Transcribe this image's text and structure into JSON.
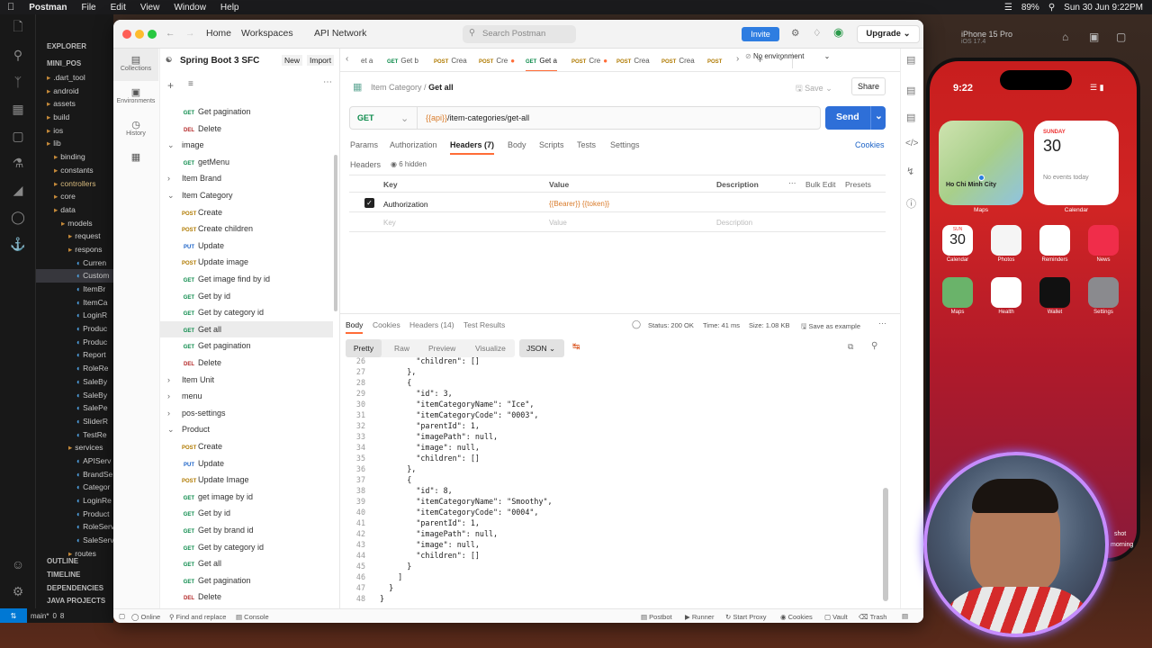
{
  "menubar": {
    "app": "Postman",
    "items": [
      "File",
      "Edit",
      "View",
      "Window",
      "Help"
    ],
    "battery": "89%",
    "datetime": "Sun 30 Jun  9:22PM"
  },
  "vscode": {
    "explorer": "EXPLORER",
    "project": "MINI_POS",
    "tree": [
      ".dart_tool",
      "android",
      "assets",
      "build",
      "ios",
      "lib",
      "binding",
      "constants",
      "controllers",
      "core",
      "data",
      "models",
      "request",
      "respons",
      "Curren",
      "Custom",
      "ItemBr",
      "ItemCa",
      "LoginR",
      "Produc",
      "Produc",
      "Report",
      "RoleRe",
      "SaleBy",
      "SaleBy",
      "SalePe",
      "SliderR",
      "TestRe",
      "services",
      "APIServ",
      "BrandSe",
      "Categor",
      "LoginRe",
      "Product",
      "RoleServ",
      "SaleServ",
      "routes"
    ],
    "outline": "OUTLINE",
    "timeline": "TIMELINE",
    "dependencies": "DEPENDENCIES",
    "java": "JAVA PROJECTS",
    "branch": "main*",
    "errors": "0",
    "warnings": "8"
  },
  "pm": {
    "nav": {
      "home": "Home",
      "workspaces": "Workspaces",
      "api": "API Network",
      "search": "Search Postman",
      "invite": "Invite",
      "upgrade": "Upgrade"
    },
    "workspace": {
      "name": "Spring Boot 3 SFC",
      "new": "New",
      "import": "Import"
    },
    "sidebar": {
      "collections": "Collections",
      "environments": "Environments",
      "history": "History"
    },
    "tree": [
      {
        "m": "GET",
        "t": "Get pagination"
      },
      {
        "m": "DEL",
        "t": "Delete"
      },
      {
        "f": "open",
        "t": "image"
      },
      {
        "m": "GET",
        "t": "getMenu"
      },
      {
        "f": "closed",
        "t": "Item Brand"
      },
      {
        "f": "open",
        "t": "Item Category"
      },
      {
        "m": "POST",
        "t": "Create"
      },
      {
        "m": "POST",
        "t": "Create children"
      },
      {
        "m": "PUT",
        "t": "Update"
      },
      {
        "m": "POST",
        "t": "Update image"
      },
      {
        "m": "GET",
        "t": "Get image find by id"
      },
      {
        "m": "GET",
        "t": "Get by id"
      },
      {
        "m": "GET",
        "t": "Get by category id"
      },
      {
        "m": "GET",
        "t": "Get all"
      },
      {
        "m": "GET",
        "t": "Get pagination"
      },
      {
        "m": "DEL",
        "t": "Delete"
      },
      {
        "f": "closed",
        "t": "Item Unit"
      },
      {
        "f": "closed",
        "t": "menu"
      },
      {
        "f": "closed",
        "t": "pos-settings"
      },
      {
        "f": "open",
        "t": "Product"
      },
      {
        "m": "POST",
        "t": "Create"
      },
      {
        "m": "PUT",
        "t": "Update"
      },
      {
        "m": "POST",
        "t": "Update Image"
      },
      {
        "m": "GET",
        "t": "get image by id"
      },
      {
        "m": "GET",
        "t": "Get by id"
      },
      {
        "m": "GET",
        "t": "Get by brand id"
      },
      {
        "m": "GET",
        "t": "Get by category id"
      },
      {
        "m": "GET",
        "t": "Get all"
      },
      {
        "m": "GET",
        "t": "Get pagination"
      },
      {
        "m": "DEL",
        "t": "Delete"
      }
    ],
    "tabs": [
      {
        "m": "",
        "t": "et a"
      },
      {
        "m": "GET",
        "t": "Get b"
      },
      {
        "m": "POST",
        "t": "Crea"
      },
      {
        "m": "POST",
        "t": "Cre"
      },
      {
        "m": "GET",
        "t": "Get a"
      },
      {
        "m": "POST",
        "t": "Cre"
      },
      {
        "m": "POST",
        "t": "Crea"
      },
      {
        "m": "POST",
        "t": "Crea"
      },
      {
        "m": "POST",
        "t": ""
      }
    ],
    "env": "No environment",
    "crumb": {
      "parent": "Item Category",
      "current": "Get all"
    },
    "save": "Save",
    "share": "Share",
    "method": "GET",
    "url_var": "{{api}}",
    "url_path": "/item-categories/get-all",
    "send": "Send",
    "reqtabs": [
      "Params",
      "Authorization",
      "Headers (7)",
      "Body",
      "Scripts",
      "Tests",
      "Settings"
    ],
    "cookies": "Cookies",
    "headers_label": "Headers",
    "hidden": "6 hidden",
    "cols": {
      "key": "Key",
      "value": "Value",
      "desc": "Description",
      "bulk": "Bulk Edit",
      "presets": "Presets"
    },
    "row": {
      "key": "Authorization",
      "value": "{{Bearer}} {{token}}"
    },
    "empty": {
      "key": "Key",
      "value": "Value",
      "desc": "Description"
    },
    "resptabs": [
      "Body",
      "Cookies",
      "Headers (14)",
      "Test Results"
    ],
    "status": "Status: 200 OK",
    "time": "Time: 41 ms",
    "size": "Size: 1.08 KB",
    "saveex": "Save as example",
    "views": [
      "Pretty",
      "Raw",
      "Preview",
      "Visualize"
    ],
    "format": "JSON",
    "code": [
      {
        "n": "26",
        "t": "        \"children\": []"
      },
      {
        "n": "27",
        "t": "      },"
      },
      {
        "n": "28",
        "t": "      {"
      },
      {
        "n": "29",
        "t": "        \"id\": 3,"
      },
      {
        "n": "30",
        "t": "        \"itemCategoryName\": \"Ice\","
      },
      {
        "n": "31",
        "t": "        \"itemCategoryCode\": \"0003\","
      },
      {
        "n": "32",
        "t": "        \"parentId\": 1,"
      },
      {
        "n": "33",
        "t": "        \"imagePath\": null,"
      },
      {
        "n": "34",
        "t": "        \"image\": null,"
      },
      {
        "n": "35",
        "t": "        \"children\": []"
      },
      {
        "n": "36",
        "t": "      },"
      },
      {
        "n": "37",
        "t": "      {"
      },
      {
        "n": "38",
        "t": "        \"id\": 8,"
      },
      {
        "n": "39",
        "t": "        \"itemCategoryName\": \"Smoothy\","
      },
      {
        "n": "40",
        "t": "        \"itemCategoryCode\": \"0004\","
      },
      {
        "n": "41",
        "t": "        \"parentId\": 1,"
      },
      {
        "n": "42",
        "t": "        \"imagePath\": null,"
      },
      {
        "n": "43",
        "t": "        \"image\": null,"
      },
      {
        "n": "44",
        "t": "        \"children\": []"
      },
      {
        "n": "45",
        "t": "      }"
      },
      {
        "n": "46",
        "t": "    ]"
      },
      {
        "n": "47",
        "t": "  }"
      },
      {
        "n": "48",
        "t": "}"
      }
    ],
    "footer": {
      "online": "Online",
      "find": "Find and replace",
      "console": "Console",
      "postbot": "Postbot",
      "runner": "Runner",
      "proxy": "Start Proxy",
      "cookies": "Cookies",
      "vault": "Vault",
      "trash": "Trash"
    }
  },
  "phone": {
    "sim": "iPhone 15 Pro",
    "ios": "iOS 17.4",
    "time": "9:22",
    "maps_city": "Ho Chi Minh City",
    "maps_lbl": "Maps",
    "cal_day": "SUNDAY",
    "cal_date": "30",
    "cal_note": "No events today",
    "cal_lbl": "Calendar",
    "apps": [
      {
        "n": "Calendar",
        "c": "#ffffff"
      },
      {
        "n": "Photos",
        "c": "#f5f5f5"
      },
      {
        "n": "Reminders",
        "c": "#ffffff"
      },
      {
        "n": "News",
        "c": "#f02d4a"
      },
      {
        "n": "Maps",
        "c": "#6ab36a"
      },
      {
        "n": "Health",
        "c": "#ffffff"
      },
      {
        "n": "Wallet",
        "c": "#111111"
      },
      {
        "n": "Settings",
        "c": "#8a8a8e"
      }
    ],
    "cal_sun": "SUN",
    "cal_num": "30",
    "side1": "shot",
    "side2": "morning"
  }
}
